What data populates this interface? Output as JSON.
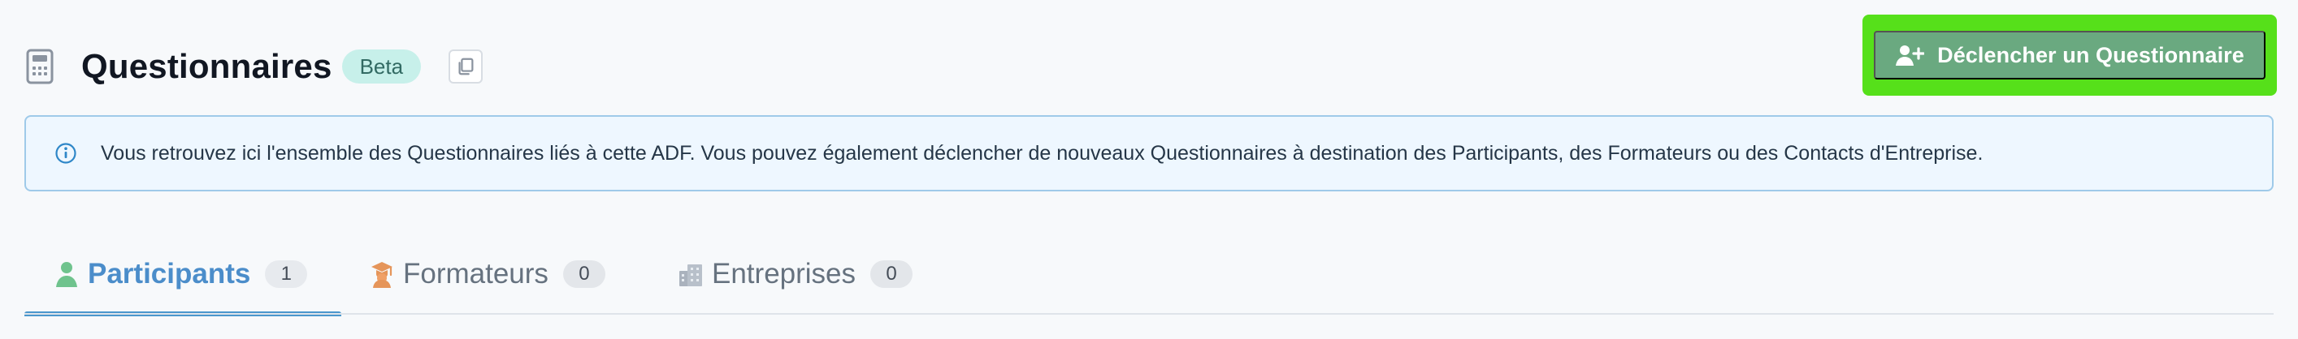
{
  "header": {
    "title": "Questionnaires",
    "badge": "Beta",
    "icons": {
      "title": "calculator-icon",
      "copy": "copy-icon",
      "trigger": "user-plus-icon"
    },
    "action_label": "Déclencher un Questionnaire"
  },
  "info": {
    "icon": "info-icon",
    "message": "Vous retrouvez ici l'ensemble des Questionnaires liés à cette ADF. Vous pouvez également déclencher de nouveaux Questionnaires à destination des Participants, des Formateurs ou des Contacts d'Entreprise."
  },
  "tabs": [
    {
      "label": "Participants",
      "count": "1",
      "icon": "user-icon",
      "active": true
    },
    {
      "label": "Formateurs",
      "count": "0",
      "icon": "graduation-cap-icon",
      "active": false
    },
    {
      "label": "Entreprises",
      "count": "0",
      "icon": "building-icon",
      "active": false
    }
  ],
  "colors": {
    "page_background": "#f7f9fb",
    "highlight_outline": "#56e01a",
    "action_button": "#6aa980",
    "badge_background": "#c7f0ea",
    "info_background": "#eef7ff",
    "info_border": "#9fcae9",
    "active_tab": "#4b8dca",
    "participant_icon": "#6fc38d",
    "trainer_icon": "#e5955a"
  }
}
